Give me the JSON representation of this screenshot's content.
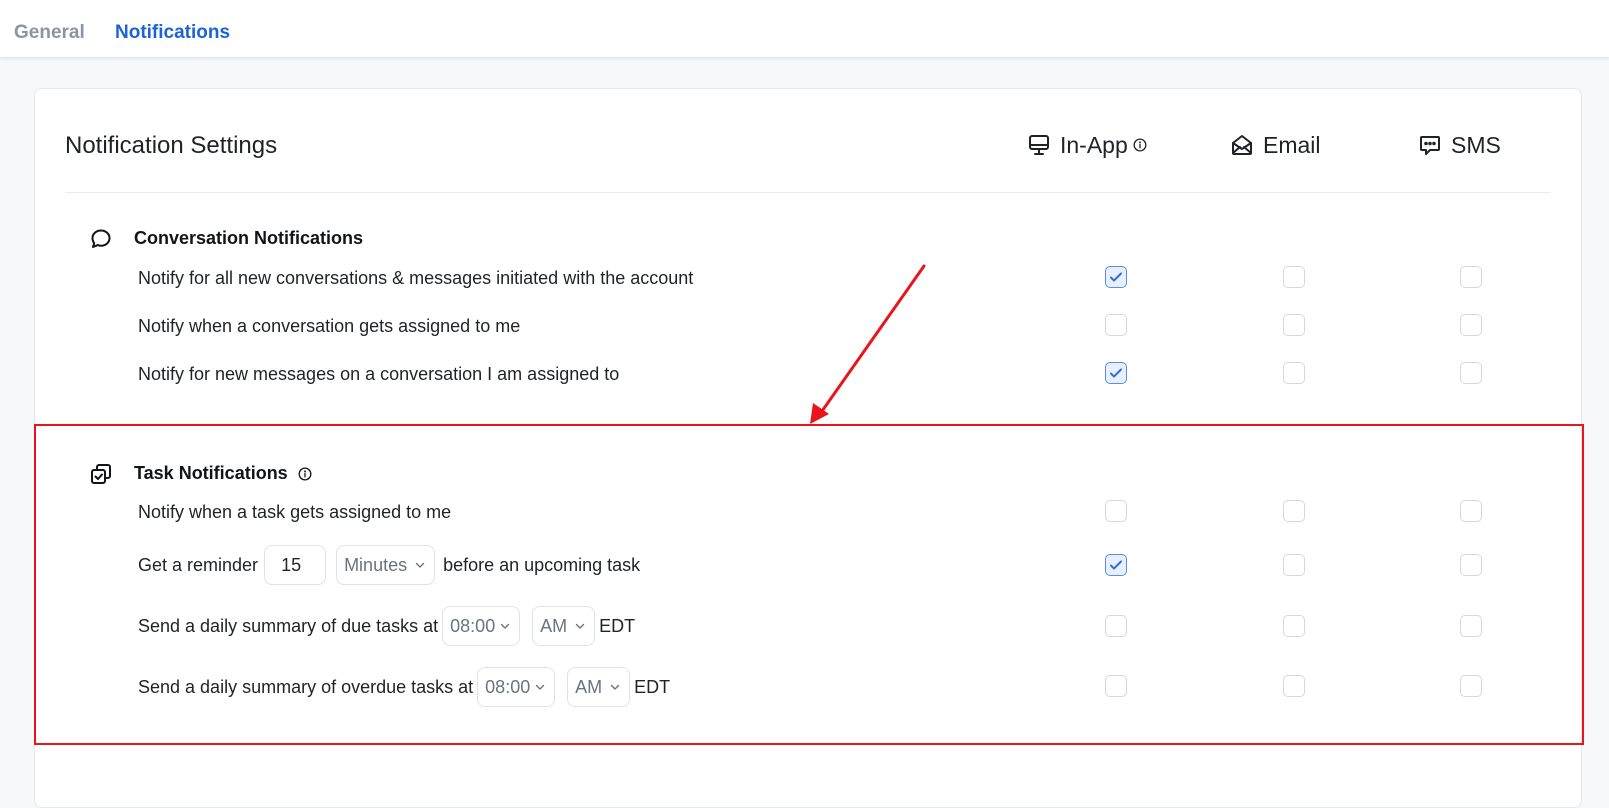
{
  "tabs": [
    {
      "label": "General",
      "active": false
    },
    {
      "label": "Notifications",
      "active": true
    }
  ],
  "card": {
    "title": "Notification Settings",
    "channels": {
      "in_app": "In-App",
      "email": "Email",
      "sms": "SMS"
    }
  },
  "sections": {
    "conversation": {
      "title": "Conversation Notifications",
      "rows": [
        {
          "label": "Notify for all new conversations & messages initiated with the account",
          "in_app": true,
          "email": false,
          "sms": false
        },
        {
          "label": "Notify when a conversation gets assigned to me",
          "in_app": false,
          "email": false,
          "sms": false
        },
        {
          "label": "Notify for new messages on a conversation I am assigned to",
          "in_app": true,
          "email": false,
          "sms": false
        }
      ]
    },
    "task": {
      "title": "Task Notifications",
      "rows": {
        "assigned": {
          "label": "Notify when a task gets assigned to me",
          "in_app": false,
          "email": false,
          "sms": false
        },
        "reminder": {
          "prefix": "Get a reminder",
          "value": "15",
          "unit": "Minutes",
          "suffix": "before an upcoming task",
          "in_app": true,
          "email": false,
          "sms": false
        },
        "due_summary": {
          "prefix": "Send a daily summary of due tasks at",
          "time": "08:00",
          "ampm": "AM",
          "tz": "EDT",
          "in_app": false,
          "email": false,
          "sms": false
        },
        "overdue_summary": {
          "prefix": "Send a daily summary of overdue tasks at",
          "time": "08:00",
          "ampm": "AM",
          "tz": "EDT",
          "in_app": false,
          "email": false,
          "sms": false
        }
      }
    }
  },
  "colors": {
    "accent": "#1d63d6",
    "annotation": "#e8151b"
  }
}
